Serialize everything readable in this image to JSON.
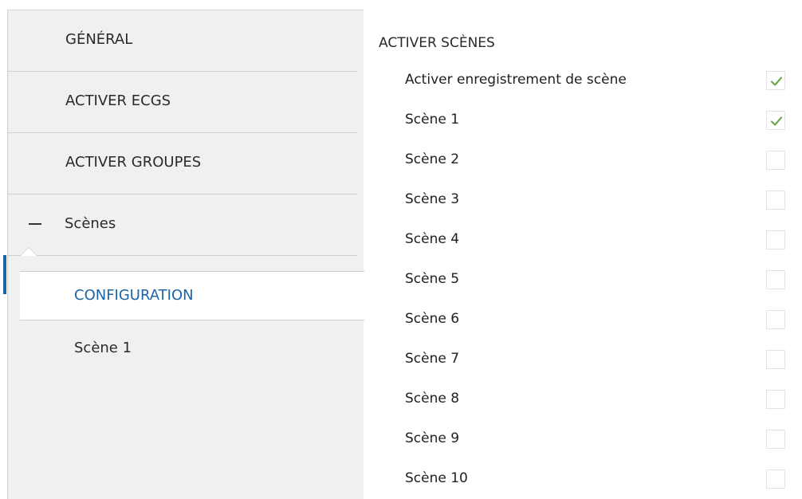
{
  "sidebar": {
    "items": [
      {
        "label": "GÉNÉRAL"
      },
      {
        "label": "ACTIVER ECGS"
      },
      {
        "label": "ACTIVER GROUPES"
      },
      {
        "label": "Scènes",
        "collapse_symbol": "−"
      }
    ],
    "selected": {
      "label": "CONFIGURATION"
    },
    "sub_items": [
      {
        "label": "Scène 1"
      }
    ]
  },
  "panel": {
    "title": "ACTIVER SCÈNES",
    "rows": [
      {
        "label": "Activer enregistrement de scène",
        "checked": true
      },
      {
        "label": "Scène 1",
        "checked": true
      },
      {
        "label": "Scène 2",
        "checked": false
      },
      {
        "label": "Scène 3",
        "checked": false
      },
      {
        "label": "Scène 4",
        "checked": false
      },
      {
        "label": "Scène 5",
        "checked": false
      },
      {
        "label": "Scène 6",
        "checked": false
      },
      {
        "label": "Scène 7",
        "checked": false
      },
      {
        "label": "Scène 8",
        "checked": false
      },
      {
        "label": "Scène 9",
        "checked": false
      },
      {
        "label": "Scène 10",
        "checked": false
      }
    ]
  },
  "colors": {
    "accent": "#1e64a8",
    "check": "#6aaa4a",
    "sidebar_bg": "#f0f0f0"
  },
  "icons": {
    "collapse": "minus-icon",
    "checked": "check-icon"
  }
}
